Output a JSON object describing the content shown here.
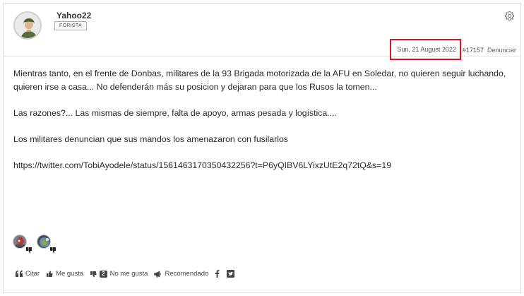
{
  "post": {
    "author": {
      "username": "Yahoo22",
      "role": "FORISTA",
      "avatar_icon": "soldier-avatar-icon"
    },
    "meta": {
      "date": "Sun, 21 August 2022",
      "post_number": "#17157",
      "report_label": "Denunciar",
      "highlight_color": "#e0141e"
    },
    "body": {
      "paragraph_1": "Mientras tanto,  en el frente de Donbas, militares de la 93 Brigada motorizada de la AFU en Soledar,  no quieren seguir luchando,  quieren irse a casa... No defenderán más su posicion y dejaran para que los Rusos la tomen...",
      "paragraph_2": "Las razones?... Las mismas de siempre, falta de apoyo,  armas pesada y logística....",
      "paragraph_3": "Los militares denuncian que sus mandos los amenazaron con fusilarlos",
      "link": "https://twitter.com/TobiAyodele/status/1561463170350432256?t=P6yQIBV6LYixzUtE2q72tQ&s=19"
    },
    "reactions": {
      "reactors": [
        {
          "icon": "user-avatar-icon",
          "reaction": "thumbs-down-icon"
        },
        {
          "icon": "user-avatar-icon",
          "reaction": "thumbs-down-icon"
        }
      ]
    },
    "actions": {
      "quote_label": "Citar",
      "like_label": "Me gusta",
      "dislike_count": "2",
      "dislike_label": "No me gusta",
      "recommend_label": "Recomendado",
      "share_icons": [
        "facebook-icon",
        "twitter-icon"
      ]
    }
  }
}
